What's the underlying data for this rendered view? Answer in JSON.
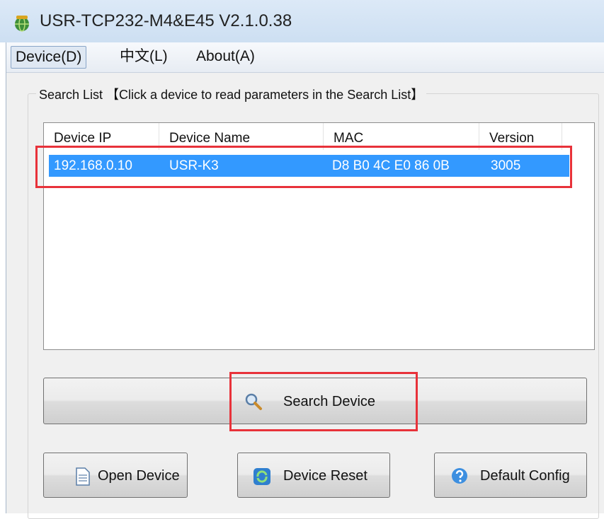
{
  "window": {
    "title": "USR-TCP232-M4&E45 V2.1.0.38",
    "icon": "app-globe-icon"
  },
  "menu": [
    {
      "label": "Device(D)",
      "active": true
    },
    {
      "label": "中文(L)",
      "active": false
    },
    {
      "label": "About(A)",
      "active": false
    }
  ],
  "search_group": {
    "title": "Search List 【Click a device to read parameters in the Search List】"
  },
  "device_list": {
    "columns": [
      "Device IP",
      "Device Name",
      "MAC",
      "Version"
    ],
    "rows": [
      {
        "ip": "192.168.0.10",
        "name": "USR-K3",
        "mac": "D8 B0 4C E0 86 0B",
        "version": "3005",
        "selected": true
      }
    ]
  },
  "buttons": {
    "search": {
      "label": "Search Device",
      "icon": "magnifier-icon"
    },
    "open": {
      "label": "Open Device",
      "icon": "document-icon"
    },
    "reset": {
      "label": "Device Reset",
      "icon": "refresh-icon"
    },
    "default": {
      "label": "Default Config",
      "icon": "help-icon"
    }
  },
  "highlight_color": "#e8323a",
  "selection_color": "#3399ff"
}
